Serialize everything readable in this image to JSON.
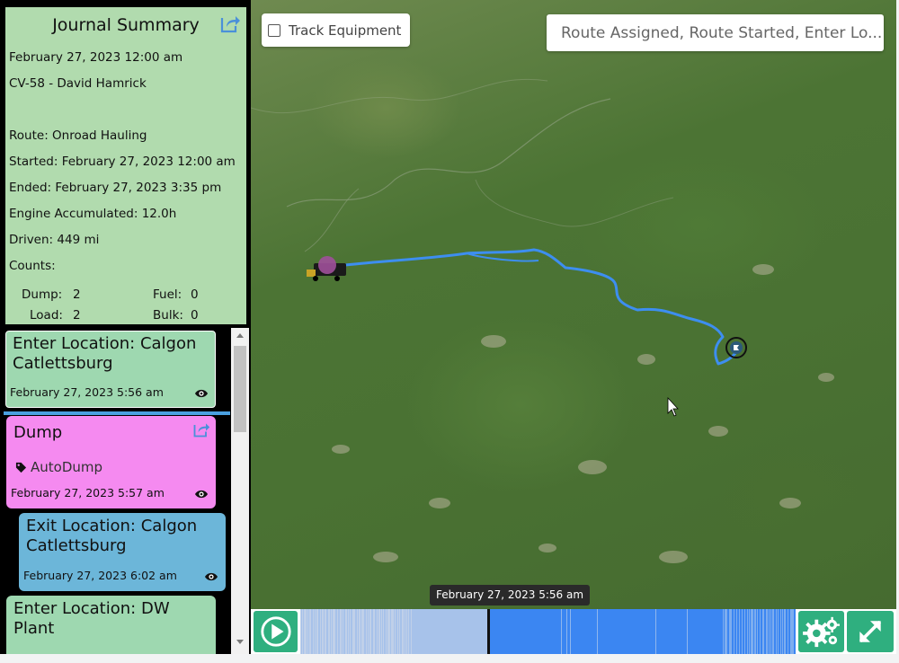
{
  "summary": {
    "title": "Journal Summary",
    "date": "February 27, 2023 12:00 am",
    "vehicle": "CV-58 - David Hamrick",
    "route": "Route: Onroad Hauling",
    "started": "Started: February 27, 2023 12:00 am",
    "ended": "Ended: February 27, 2023 3:35 pm",
    "engine": "Engine Accumulated: 12.0h",
    "driven": "Driven: 449 mi",
    "counts_label": "Counts:",
    "counts": {
      "dump_label": "Dump:",
      "dump_value": "2",
      "fuel_label": "Fuel:",
      "fuel_value": "0",
      "load_label": "Load:",
      "load_value": "2",
      "bulk_label": "Bulk:",
      "bulk_value": "0"
    }
  },
  "events": [
    {
      "title": "Enter Location: Calgon Catlettsburg",
      "time": "February 27, 2023 5:56 am",
      "color": "#9ed8b0"
    },
    {
      "title": "Dump",
      "tag": "AutoDump",
      "time": "February 27, 2023 5:57 am",
      "color": "#f58af0"
    },
    {
      "title": "Exit Location: Calgon Catlettsburg",
      "time": "February 27, 2023 6:02 am",
      "color": "#6cb6d9"
    },
    {
      "title": "Enter Location: DW Plant",
      "color": "#9ed8b0"
    }
  ],
  "map": {
    "track_equipment_label": "Track Equipment",
    "track_equipment_checked": false,
    "search_placeholder": "Route Assigned, Route Started, Enter Lo...",
    "tooltip": "February 27, 2023 5:56 am",
    "route_color": "#3d8ef0"
  },
  "playback": {
    "progress": 0.38,
    "accent": "#2faf7f",
    "timeline_past": "#a7c2ea",
    "timeline_future": "#3b86f2"
  }
}
